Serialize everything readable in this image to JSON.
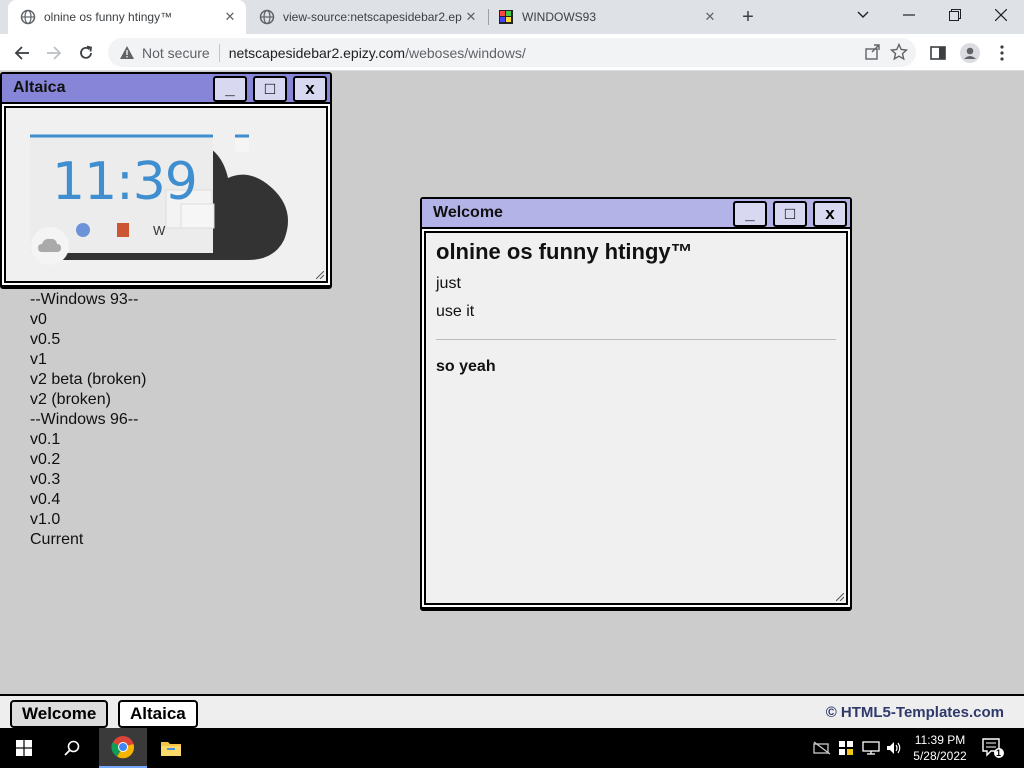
{
  "browser": {
    "tabs": [
      {
        "title": "olnine os funny htingy™"
      },
      {
        "title": "view-source:netscapesidebar2.ep"
      },
      {
        "title": "WINDOWS93"
      }
    ],
    "address": {
      "security": "Not secure",
      "host": "netscapesidebar2.epizy.com",
      "path": "/weboses/windows/"
    }
  },
  "altaica_window": {
    "title": "Altaica",
    "preview": {
      "time": "11:39",
      "label": "W"
    }
  },
  "version_list": [
    "--Windows 93--",
    "v0",
    "v0.5",
    "v1",
    "v2 beta (broken)",
    "v2 (broken)",
    "--Windows 96--",
    "v0.1",
    "v0.2",
    "v0.3",
    "v0.4",
    "v1.0",
    "Current"
  ],
  "welcome_window": {
    "title": "Welcome",
    "heading": "olnine os funny htingy™",
    "line1": "just",
    "line2": "use it",
    "footer": "so yeah"
  },
  "window_buttons": {
    "minimize": "_",
    "maximize": "□",
    "close": "x"
  },
  "os_taskbar": {
    "tasks": [
      {
        "label": "Welcome"
      },
      {
        "label": "Altaica"
      }
    ],
    "credit": "© HTML5-Templates.com"
  },
  "windows_taskbar": {
    "time": "11:39 PM",
    "date": "5/28/2022",
    "notification_count": "1"
  },
  "colors": {
    "titlebar_active": "#8785d8",
    "titlebar_welcome": "#b3b3e8",
    "desktop": "#cccccc"
  }
}
